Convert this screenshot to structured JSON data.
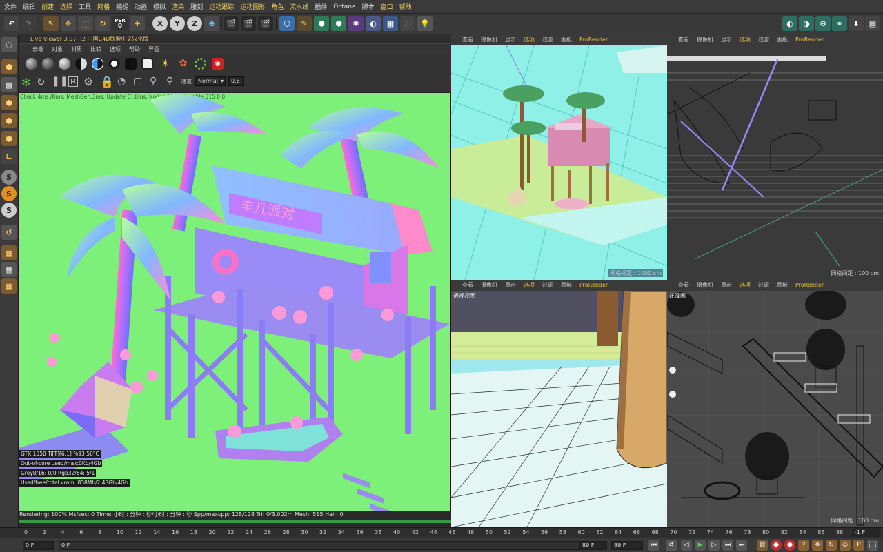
{
  "menubar": {
    "items": [
      "文件",
      "编辑",
      "创建",
      "选择",
      "工具",
      "网格",
      "捕捉",
      "动画",
      "模拟",
      "渲染",
      "雕刻",
      "运动跟踪",
      "运动图形",
      "角色",
      "流水线",
      "插件",
      "Octane",
      "脚本",
      "窗口",
      "帮助"
    ],
    "highlighted": [
      "创建",
      "选择",
      "网格",
      "渲染",
      "运动跟踪",
      "运动图形",
      "角色",
      "流水线",
      "窗口",
      "帮助"
    ]
  },
  "toolbar": {
    "psr_label": "PSR",
    "psr_value": "0",
    "axis_x": "X",
    "axis_y": "Y",
    "axis_z": "Z"
  },
  "live_viewer": {
    "title": "Live Viewer 3.07-R2 中国C4D联盟中文汉化版",
    "menu": [
      "云端",
      "对象",
      "材质",
      "比较",
      "选项",
      "帮助",
      "界面"
    ],
    "channel_label": "通道:",
    "channel_value": "Normal",
    "value_field": "0.6",
    "check_line": "Check:4ms./8ms. MeshGen:3ms. Update[C]:0ms. Nodes:1061 Movable:515  0 0",
    "sign_text": "丰几派对",
    "stats": [
      "GTX 1050 Ti[T][6.1]        %93    56°C",
      "Out-of-core used/max:0Kb/4Gb",
      "Grey8/16: 0/0          Rgb32/64: 5/1",
      "Used/free/total vram: 838Mb/2.43Gb/4Gb"
    ],
    "render_status": "Rendering: 100%   Ms/sec: 0    Time: 小时 : 分钟 : 秒/小时 : 分钟 : 秒   Spp/maxspp: 128/128      Tri: 0/3.002m  Mesh: 515  Hair: 0"
  },
  "viewports": [
    {
      "menu": [
        "查看",
        "摄像机",
        "显示",
        "选项",
        "过滤",
        "面板",
        "ProRender"
      ],
      "grid": "网格间距 : 1000 cm",
      "label": ""
    },
    {
      "menu": [
        "查看",
        "摄像机",
        "显示",
        "选项",
        "过滤",
        "面板",
        "ProRender"
      ],
      "grid": "网格间距 : 100 cm",
      "label": ""
    },
    {
      "menu": [
        "查看",
        "摄像机",
        "显示",
        "选项",
        "过滤",
        "面板",
        "ProRender"
      ],
      "grid": "",
      "label": "透视视图"
    },
    {
      "menu": [
        "查看",
        "摄像机",
        "显示",
        "选项",
        "过滤",
        "面板",
        "ProRender"
      ],
      "grid": "网格间距 : 100 cm",
      "label": "正视图"
    }
  ],
  "timeline": {
    "ticks": [
      "0",
      "2",
      "4",
      "6",
      "8",
      "10",
      "12",
      "14",
      "16",
      "18",
      "20",
      "22",
      "24",
      "26",
      "28",
      "30",
      "32",
      "34",
      "36",
      "38",
      "40",
      "42",
      "44",
      "46",
      "48",
      "50",
      "52",
      "54",
      "56",
      "58",
      "60",
      "62",
      "64",
      "66",
      "68",
      "70",
      "72",
      "74",
      "76",
      "78",
      "80",
      "82",
      "84",
      "86",
      "88",
      "90"
    ],
    "frame_indicator": "-1 F"
  },
  "transport": {
    "start_frame": "0 F",
    "current_frame": "0 F",
    "end_frame_a": "89 F",
    "end_frame_b": "89 F"
  },
  "colors": {
    "render_bg": "#7df07a",
    "accent": "#f0c040",
    "ui_dark": "#2b2b2b"
  }
}
